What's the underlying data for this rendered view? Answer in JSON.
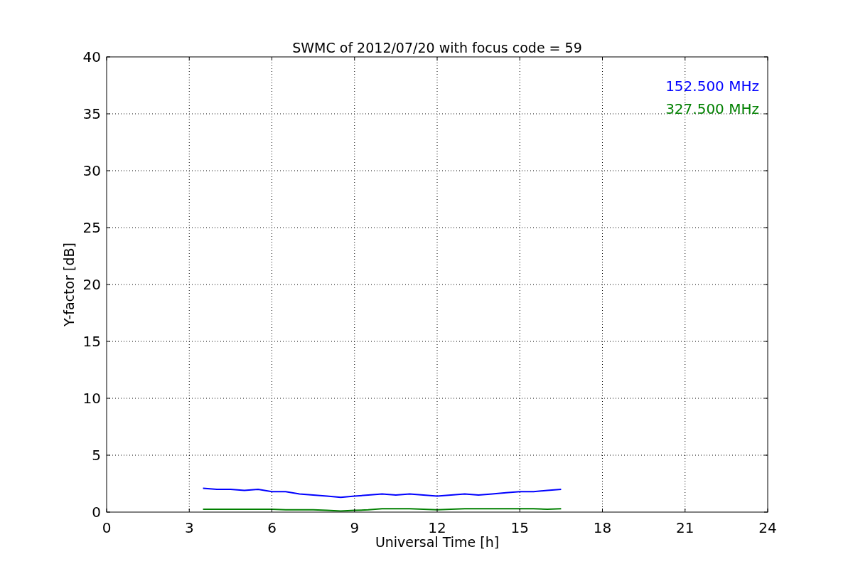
{
  "figure": {
    "chart_data": {
      "type": "line",
      "title": "SWMC of 2012/07/20 with focus code = 59",
      "xlabel": "Universal Time [h]",
      "ylabel": "Y-factor [dB]",
      "x": [
        3.5,
        4,
        4.5,
        5,
        5.5,
        6,
        6.5,
        7,
        7.5,
        8,
        8.5,
        9,
        9.5,
        10,
        10.5,
        11,
        11.5,
        12,
        12.5,
        13,
        13.5,
        14,
        14.5,
        15,
        15.5,
        16,
        16.5
      ],
      "series": [
        {
          "name": "152.500 MHz",
          "color": "#0000ff",
          "values": [
            2.1,
            2.0,
            2.0,
            1.9,
            2.0,
            1.8,
            1.8,
            1.6,
            1.5,
            1.4,
            1.3,
            1.4,
            1.5,
            1.6,
            1.5,
            1.6,
            1.5,
            1.4,
            1.5,
            1.6,
            1.5,
            1.6,
            1.7,
            1.8,
            1.8,
            1.9,
            2.0
          ]
        },
        {
          "name": "327.500 MHz",
          "color": "#008000",
          "values": [
            0.25,
            0.25,
            0.25,
            0.25,
            0.25,
            0.25,
            0.2,
            0.2,
            0.2,
            0.15,
            0.1,
            0.15,
            0.2,
            0.3,
            0.3,
            0.3,
            0.25,
            0.2,
            0.25,
            0.3,
            0.3,
            0.3,
            0.3,
            0.3,
            0.3,
            0.25,
            0.3
          ]
        }
      ],
      "xlim": [
        0,
        24
      ],
      "ylim": [
        0,
        40
      ],
      "xticks": [
        0,
        3,
        6,
        9,
        12,
        15,
        18,
        21,
        24
      ],
      "yticks": [
        0,
        5,
        10,
        15,
        20,
        25,
        30,
        35,
        40
      ],
      "grid": true
    }
  }
}
